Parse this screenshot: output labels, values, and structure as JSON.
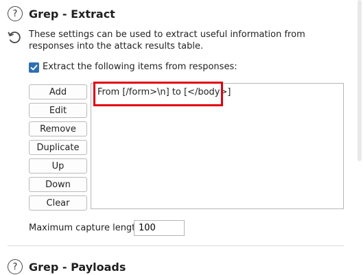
{
  "grep_extract": {
    "title": "Grep - Extract",
    "description": "These settings can be used to extract useful information from responses into the attack results table.",
    "checkbox_label": "Extract the following items from responses:",
    "checkbox_checked": true,
    "buttons": {
      "add": "Add",
      "edit": "Edit",
      "remove": "Remove",
      "duplicate": "Duplicate",
      "up": "Up",
      "down": "Down",
      "clear": "Clear"
    },
    "items": [
      "From [/form>\\n] to [</body>]"
    ],
    "max_capture_label": "Maximum capture length:",
    "max_capture_value": "100"
  },
  "grep_payloads": {
    "title": "Grep - Payloads"
  },
  "colors": {
    "accent": "#2f6fb3",
    "highlight": "#e1000f"
  }
}
